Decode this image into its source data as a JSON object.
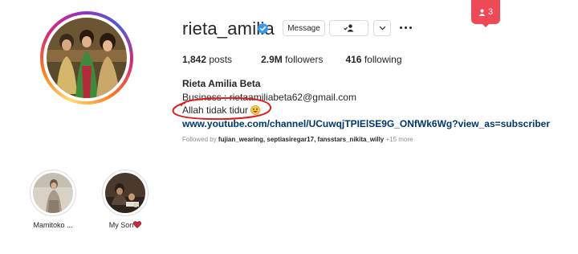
{
  "profile": {
    "username": "rieta_amilia",
    "full_name": "Rieta Amilia Beta",
    "verified": true,
    "verified_icon": "verified-badge-icon"
  },
  "actions": {
    "message_label": "Message",
    "following_icon": "person-check-icon",
    "more_icon": "chevron-down-icon",
    "options_icon": "more-horizontal-icon"
  },
  "notification": {
    "icon": "person-icon",
    "count": "3",
    "color": "#ed4956"
  },
  "stats": {
    "posts_count": "1,842",
    "posts_label": "posts",
    "followers_count": "2.9M",
    "followers_label": "followers",
    "following_count": "416",
    "following_label": "following"
  },
  "bio": {
    "line1": "Business : rietaamiliabeta62@gmail.com",
    "line2": "Allah tidak tidur",
    "line2_emoji": "smiling-face-icon",
    "link": "www.youtube.com/channel/UCuwqjTPIElSE9G_ONfWk6Wg?view_as=subscriber"
  },
  "followed_by": {
    "prefix": "Followed by",
    "names": "fujian_wearing, septiasiregar17, fansstars_nikita_willy",
    "more": "+15 more"
  },
  "highlights": [
    {
      "label": "Mamitoko ..."
    },
    {
      "label": "My Son",
      "emoji": "heart-icon"
    }
  ],
  "annotation": {
    "color": "#e01b1b",
    "shape": "ellipse"
  }
}
